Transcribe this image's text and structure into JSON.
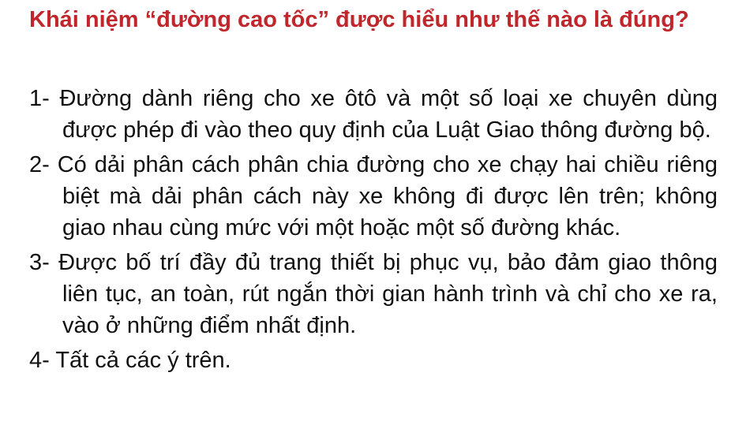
{
  "question": {
    "text": "Khái niệm “đường cao tốc” được hiểu như thế nào là đúng?",
    "color": "#c0272d"
  },
  "answers": [
    {
      "text": "1- Đường dành riêng cho xe ôtô và một số loại xe chuyên dùng được phép đi vào theo quy định của Luật Giao thông đường bộ."
    },
    {
      "text": "2- Có dải phân cách phân chia đường cho xe chạy hai chiều riêng biệt mà dải phân cách này xe không đi được lên trên; không giao nhau cùng mức với một hoặc một số đường khác."
    },
    {
      "text": "3- Được bố trí đầy đủ trang thiết bị phục vụ, bảo đảm giao thông liên tục, an toàn, rút ngắn thời gian hành trình và chỉ cho xe ra, vào ở những điểm nhất định."
    },
    {
      "text": "4- Tất cả các ý trên."
    }
  ]
}
